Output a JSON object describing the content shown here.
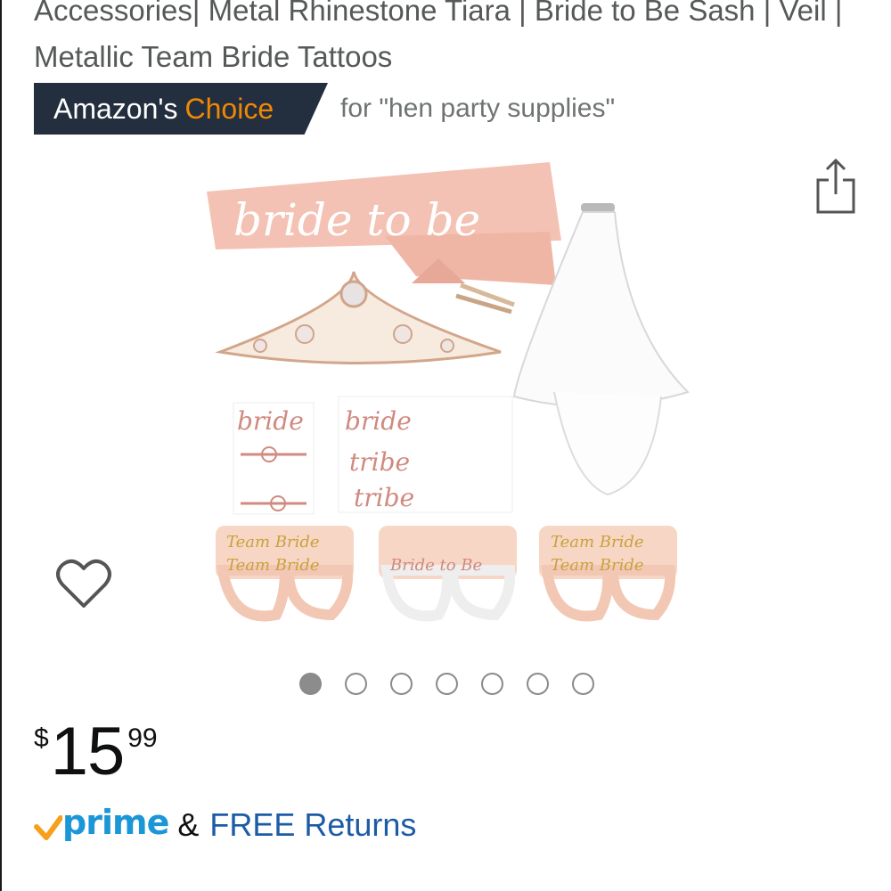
{
  "product": {
    "title": "Accessories| Metal Rhinestone Tiara | Bride to Be Sash | Veil | Metallic Team Bride Tattoos"
  },
  "badge": {
    "prefix": "Amazon's",
    "highlight": "Choice",
    "context": "for \"hen party supplies\""
  },
  "image": {
    "sash_text": "bride to be",
    "tattoo_words": [
      "bride",
      "bride",
      "tribe",
      "tribe"
    ],
    "glasses_text": [
      "Team Bride",
      "Team Bride",
      "Bride to Be",
      "Team Bride",
      "Team Bride"
    ]
  },
  "carousel": {
    "total_images": 7,
    "active_index": 0
  },
  "price": {
    "symbol": "$",
    "whole": "15",
    "fraction": "99"
  },
  "shipping": {
    "prime_label": "prime",
    "ampersand": "&",
    "returns_label": "FREE Returns"
  },
  "colors": {
    "badge_bg": "#232f3e",
    "badge_accent": "#f08804",
    "prime_blue": "#1b96d7",
    "prime_check": "#f7a01b",
    "link_blue": "#1d5ba5"
  },
  "icons": {
    "share": "share-icon",
    "wishlist": "heart-icon",
    "prime": "prime-check-icon"
  }
}
